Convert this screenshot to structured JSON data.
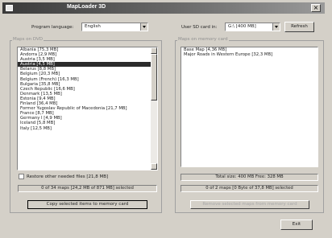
{
  "window": {
    "title": "MapLoader 3D",
    "close_glyph": "×"
  },
  "top": {
    "program_language_label": "Program language:",
    "language_value": "English",
    "sd_card_label": "User SD card in:",
    "sd_card_value": "G:\\ [400 MB]",
    "refresh_label": "Refresh"
  },
  "maps_on_dvd": {
    "group_label": "Maps on DVD",
    "items": [
      "Albania [75,3 MB]",
      "Andorra [2,9 MB]",
      "Austria [3,5 MB]",
      "Austria [4,5 MB]",
      "Belarus [8,8 MB]",
      "Belgium [20,3 MB]",
      "Belgium (French) [16,3 MB]",
      "Bulgaria [35,8 MB]",
      "Czech Republic [16,6 MB]",
      "Denmark [13,5 MB]",
      "Estonia [9,4 MB]",
      "Finland [36,4 MB]",
      "Former Yugoslav Republic of Macedonia [21,7 MB]",
      "France [8,7 MB]",
      "Germany I [4,9 MB]",
      "Iceland [5,8 MB]",
      "Italy [12,5 MB]"
    ],
    "selected_index": 3,
    "restore_checkbox_label": "Restore other needed files [21,8 MB]",
    "status": "0 of 34 maps [24,2 MB of 871 MB] selected",
    "copy_button": "Copy selected items to memory card"
  },
  "maps_on_card": {
    "group_label": "Maps on memory card",
    "items": [
      "Base Map [4,36 MB]",
      "Major Roads in Western Europe [32,3 MB]"
    ],
    "total_size": "Total size: 400 MB  Free: 328 MB",
    "status": "0 of 2 maps [0 Byte of 37,8 MB] selected",
    "remove_button": "Remove selected maps from memory card"
  },
  "footer": {
    "exit_label": "Exit"
  }
}
